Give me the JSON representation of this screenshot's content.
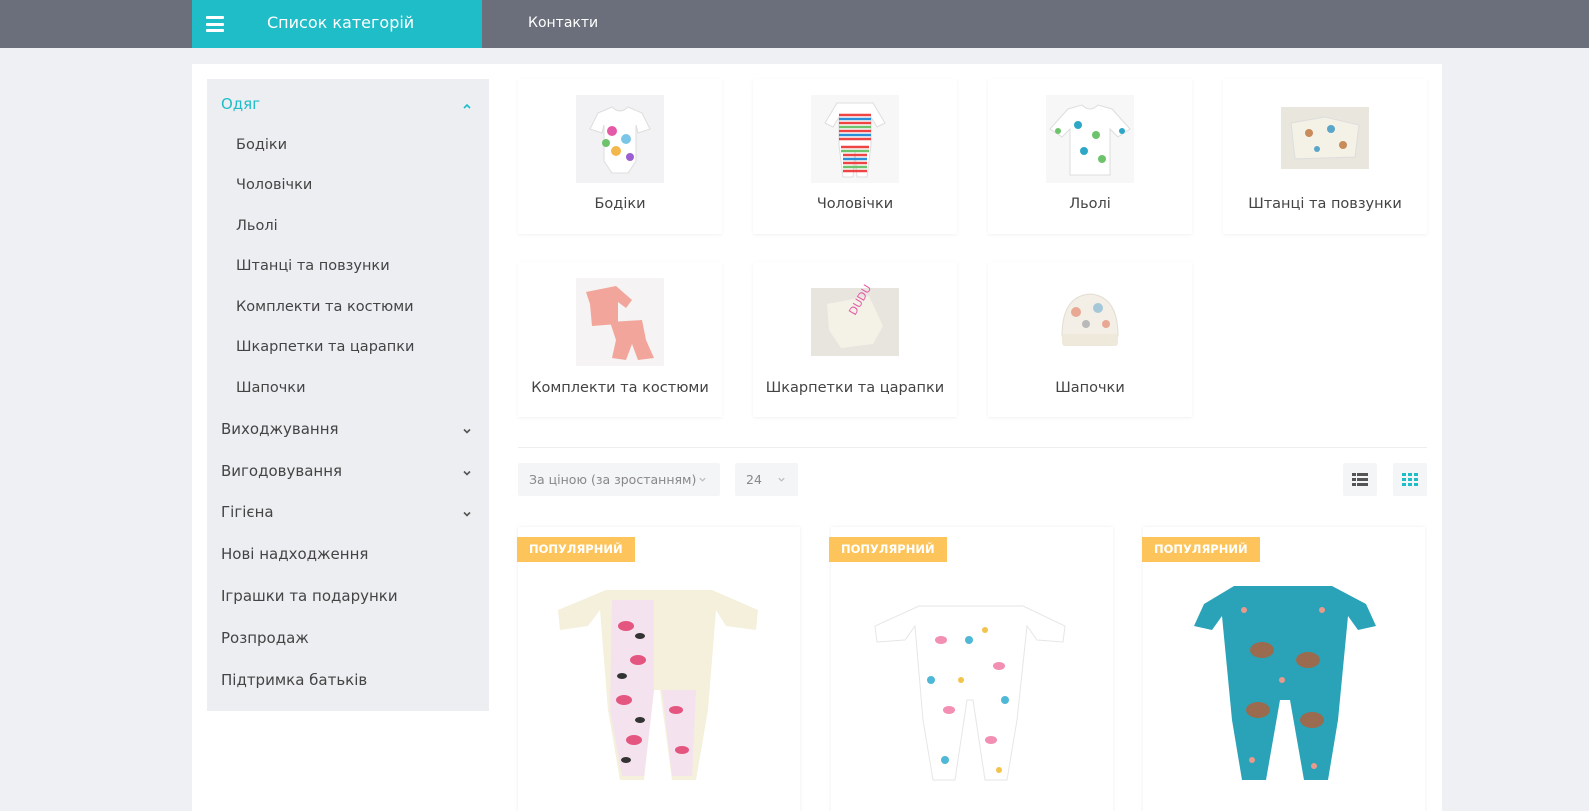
{
  "header": {
    "categories_button": "Список категорій",
    "nav": [
      "Контакти"
    ]
  },
  "sidebar": {
    "active": {
      "label": "Одяг",
      "subitems": [
        "Бодіки",
        "Чоловічки",
        "Льолі",
        "Штанці та повзунки",
        "Комплекти та костюми",
        "Шкарпетки та царапки",
        "Шапочки"
      ]
    },
    "collapsible": [
      "Виходжування",
      "Вигодовування",
      "Гігієна"
    ],
    "plain": [
      "Нові надходження",
      "Іграшки та подарунки",
      "Розпродаж",
      "Підтримка батьків"
    ]
  },
  "categories": [
    "Бодіки",
    "Чоловічки",
    "Льолі",
    "Штанці та повзунки",
    "Комплекти та костюми",
    "Шкарпетки та царапки",
    "Шапочки"
  ],
  "toolbar": {
    "sort_value": "За ціною (за зростанням)",
    "per_page_value": "24"
  },
  "products": [
    {
      "badge": "ПОПУЛЯРНИЙ"
    },
    {
      "badge": "ПОПУЛЯРНИЙ"
    },
    {
      "badge": "ПОПУЛЯРНИЙ"
    }
  ],
  "colors": {
    "accent": "#1ebdc8",
    "header": "#6a6f7b",
    "badge": "#fcc45a"
  }
}
